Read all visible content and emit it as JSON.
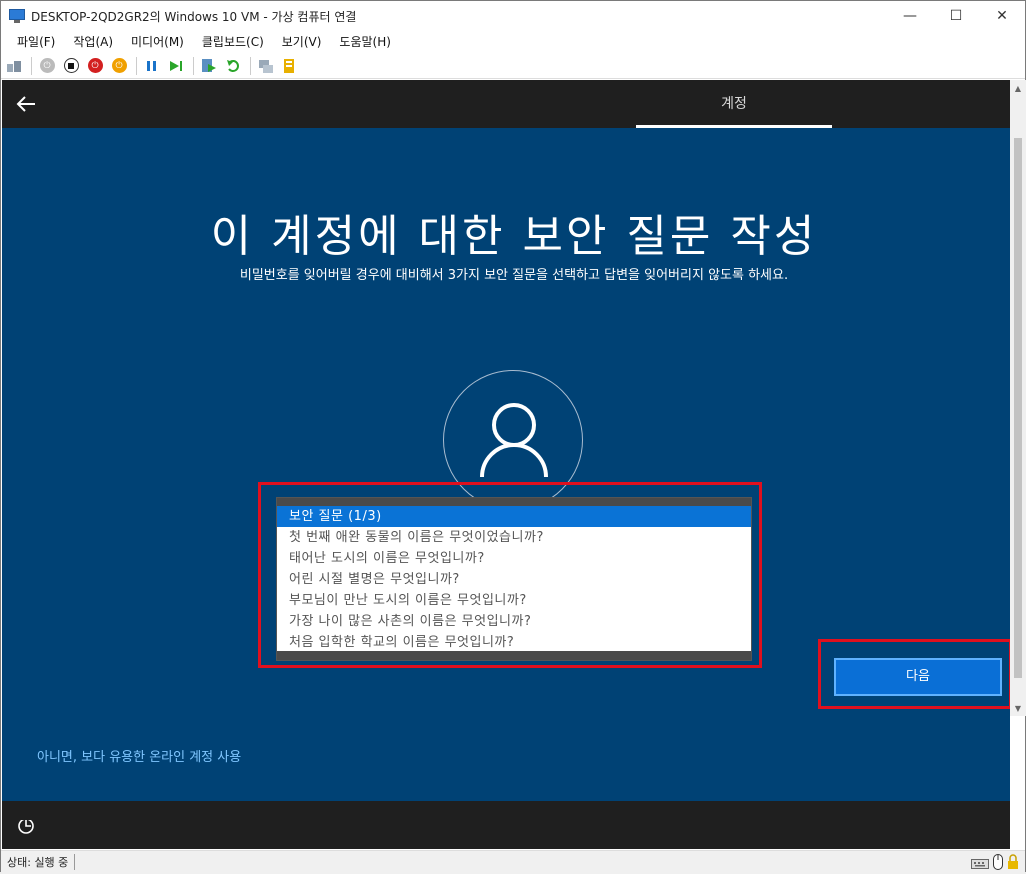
{
  "window": {
    "title": "DESKTOP-2QD2GR2의 Windows 10 VM - 가상 컴퓨터 연결",
    "controls": {
      "minimize": "—",
      "maximize": "☐",
      "close": "✕"
    }
  },
  "menu": {
    "items": [
      "파일(F)",
      "작업(A)",
      "미디어(M)",
      "클립보드(C)",
      "보기(V)",
      "도움말(H)"
    ]
  },
  "oobe": {
    "tab_label": "계정",
    "heading": "이 계정에 대한 보안 질문 작성",
    "subheading": "비밀번호를 잊어버릴 경우에 대비해서 3가지 보안 질문을 선택하고 답변을 잊어버리지 않도록 하세요.",
    "questions": [
      "보안 질문 (1/3)",
      "첫 번째 애완 동물의 이름은 무엇이었습니까?",
      "태어난 도시의 이름은 무엇입니까?",
      "어린 시절 별명은 무엇입니까?",
      "부모님이 만난 도시의 이름은 무엇입니까?",
      "가장 나이 많은 사촌의 이름은 무엇입니까?",
      "처음 입학한 학교의 이름은 무엇입니까?"
    ],
    "selected_index": 0,
    "online_link": "아니면, 보다 유용한 온라인 계정 사용",
    "next_label": "다음"
  },
  "status": {
    "text": "상태: 실행 중"
  },
  "colors": {
    "vm_bg": "#004275",
    "highlight": "#e0101e",
    "selection": "#0a73d6"
  }
}
